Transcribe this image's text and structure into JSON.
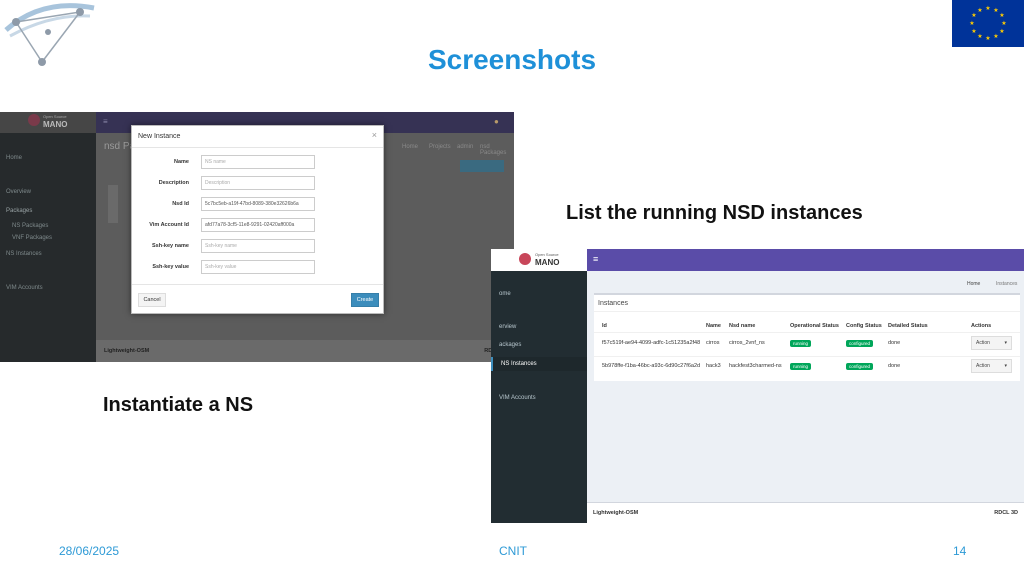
{
  "slide": {
    "title": "Screenshots",
    "caption_right": "List the running NSD instances",
    "caption_left": "Instantiate a NS",
    "footer": {
      "date": "28/06/2025",
      "center": "CNIT",
      "page": "14"
    }
  },
  "colors": {
    "title": "#1e90d8",
    "footer": "#2e9ad6",
    "eu_blue": "#003399",
    "eu_star": "#ffcc00",
    "osm_purple": "#5a4ca8",
    "status_green": "#00a65a",
    "primary_button": "#3c8dbc"
  },
  "icons": {
    "logo": "network-triangle-logo-icon",
    "flag": "eu-flag-icon",
    "osm": "open-source-mano-logo-icon"
  },
  "shot1": {
    "brand_top": "Open Source",
    "brand_name": "MANO",
    "page_title": "nsd Pa",
    "sidebar": [
      "Home",
      "Overview",
      "Packages",
      "NS Packages",
      "VNF Packages",
      "NS Instances",
      "VIM Accounts"
    ],
    "footer": "Lightweight-OSM",
    "footer_right": "RDCL 3D",
    "breadcrumb": [
      "Home",
      "Projects",
      "admin",
      "nsd Packages"
    ],
    "modal": {
      "title": "New Instance",
      "close": "×",
      "fields": [
        {
          "label": "Name",
          "value": "",
          "placeholder": "NS name"
        },
        {
          "label": "Description",
          "value": "",
          "placeholder": "Description"
        },
        {
          "label": "Nsd Id",
          "value": "5c7bc5eb-a19f-47bd-8089-380e32626b6a",
          "placeholder": ""
        },
        {
          "label": "Vim Account Id",
          "value": "afd77a78-3cf5-11e8-9291-02420aff000a",
          "placeholder": ""
        },
        {
          "label": "Ssh-key name",
          "value": "",
          "placeholder": "Ssh-key name"
        },
        {
          "label": "Ssh-key value",
          "value": "",
          "placeholder": "Ssh-key value"
        }
      ],
      "cancel": "Cancel",
      "create": "Create"
    }
  },
  "shot2": {
    "brand_top": "Open Source",
    "brand_name": "MANO",
    "menu_icon": "≡",
    "breadcrumb_home": "Home",
    "breadcrumb_current": "Instances",
    "sidebar": [
      "ome",
      "erview",
      "ackages",
      "NS Instances",
      "VIM Accounts"
    ],
    "box_title": "Instances",
    "headers": [
      "Id",
      "Name",
      "Nsd name",
      "Operational Status",
      "Config Status",
      "Detailed Status",
      "Actions"
    ],
    "rows": [
      {
        "id": "f57c519f-ae94-4099-adfc-1c51235a2f48",
        "name": "cirros",
        "nsd": "cirros_2vnf_ns",
        "op": "running",
        "cfg": "configured",
        "detail": "done",
        "action": "Action"
      },
      {
        "id": "5b978ffe-f1ba-46bc-a93c-6d90c27f6a2d",
        "name": "hack3",
        "nsd": "hackfest3charmed-ns",
        "op": "running",
        "cfg": "configured",
        "detail": "done",
        "action": "Action"
      }
    ],
    "footer": "Lightweight-OSM",
    "footer_right": "RDCL 3D"
  }
}
